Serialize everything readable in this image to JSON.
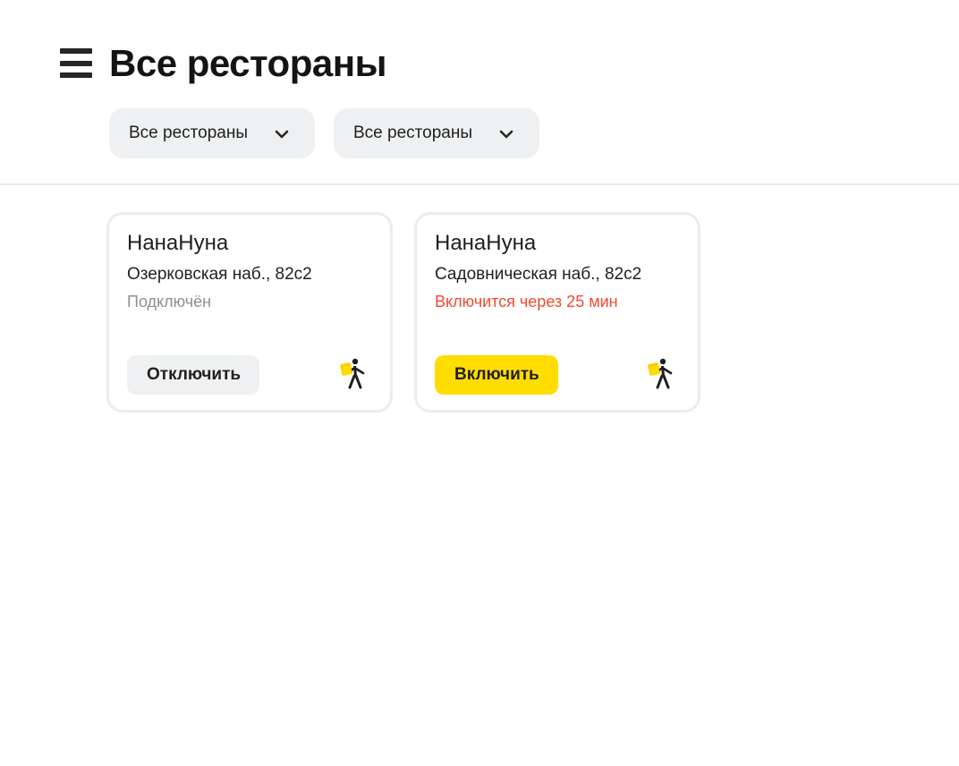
{
  "header": {
    "title": "Все рестораны",
    "filters": [
      {
        "label": "Все рестораны"
      },
      {
        "label": "Все рестораны"
      }
    ]
  },
  "restaurants": [
    {
      "name": "НанаНуна",
      "address": "Озерковская наб., 82с2",
      "status": "Подключён",
      "action_label": "Отключить"
    },
    {
      "name": "НанаНуна",
      "address": "Садовническая наб., 82с2",
      "status": "Включится через 25 мин",
      "action_label": "Включить"
    }
  ],
  "colors": {
    "accent_yellow": "#ffdd00",
    "status_warning": "#f04a2f",
    "status_muted": "#8f8f8f"
  },
  "icons": {
    "menu": "menu-icon",
    "dropdown": "chevron-down-icon",
    "courier": "walking-courier-icon"
  }
}
